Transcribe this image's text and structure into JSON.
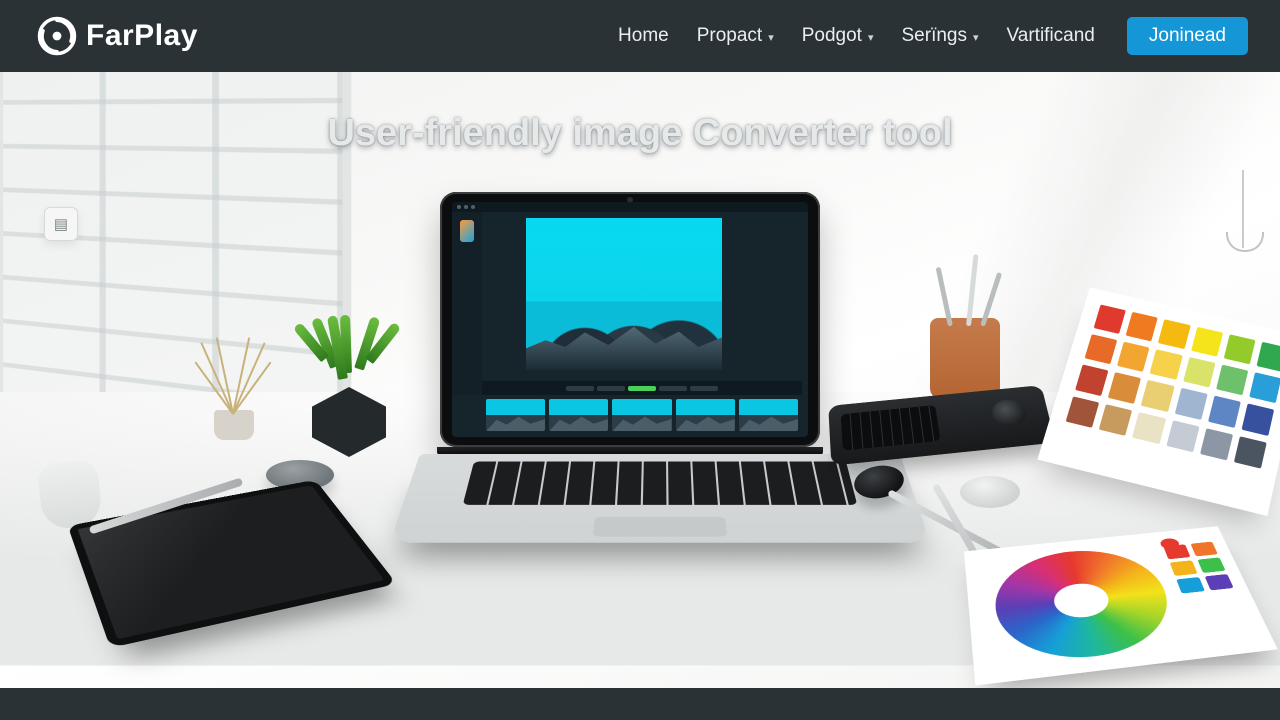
{
  "brand": {
    "name": "FarPlay"
  },
  "nav": {
    "items": [
      {
        "label": "Home",
        "has_dropdown": false
      },
      {
        "label": "Propact",
        "has_dropdown": true
      },
      {
        "label": "Podgot",
        "has_dropdown": true
      },
      {
        "label": "Serïngs",
        "has_dropdown": true
      },
      {
        "label": "Vartificand",
        "has_dropdown": false
      }
    ],
    "cta_label": "Joninead"
  },
  "hero": {
    "heading": "User-friendly image Converter tool"
  },
  "colors": {
    "navbar_bg": "#2a3236",
    "cta_bg": "#1596d7",
    "canvas_cyan": "#08d9f0"
  },
  "swatches_card": [
    "#e03a2f",
    "#ef7a1f",
    "#f5b90f",
    "#f6e41a",
    "#93c b2a",
    "#2fa84f",
    "#e76a28",
    "#f2a530",
    "#f6d24a",
    "#d9e36a",
    "#6fc06a",
    "#2a9ed8",
    "#c1432f",
    "#d98c3a",
    "#e9cf72",
    "#9fb5d0",
    "#5f86c4",
    "#37519f",
    "#a0543a",
    "#c79a5e",
    "#e9e2c4",
    "#c4cbd5",
    "#8c96a5",
    "#4b5562"
  ],
  "wheel_side_swatches": [
    "#e6392f",
    "#f0752b",
    "#f4b31a",
    "#3cc049",
    "#169ed8",
    "#5b3fb6"
  ]
}
